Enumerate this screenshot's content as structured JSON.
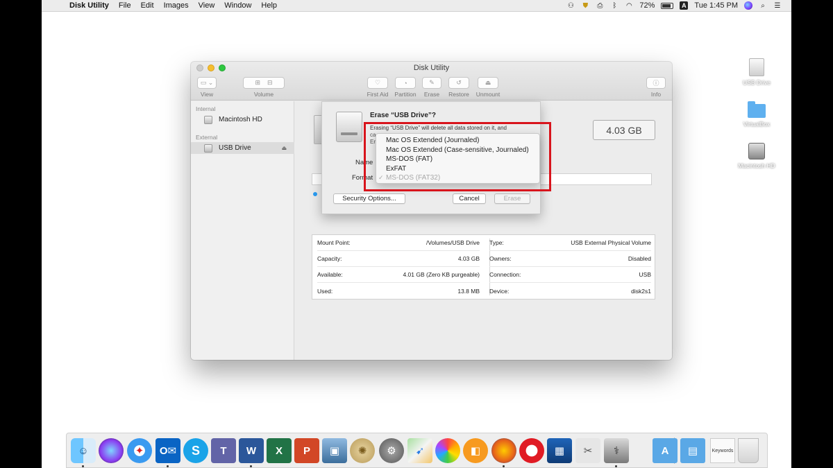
{
  "menubar": {
    "app_name": "Disk Utility",
    "menus": [
      "File",
      "Edit",
      "Images",
      "View",
      "Window",
      "Help"
    ],
    "battery": "72%",
    "keyboard_input": "A",
    "clock": "Tue 1:45 PM"
  },
  "window": {
    "title": "Disk Utility",
    "toolbar": {
      "view": "View",
      "volume": "Volume",
      "first_aid": "First Aid",
      "partition": "Partition",
      "erase": "Erase",
      "restore": "Restore",
      "unmount": "Unmount",
      "info": "Info"
    },
    "sidebar": {
      "internal_header": "Internal",
      "internal_item": "Macintosh HD",
      "external_header": "External",
      "external_item": "USB Drive"
    },
    "size": "4.03 GB",
    "info": {
      "left": [
        {
          "key": "Mount Point:",
          "value": "/Volumes/USB Drive"
        },
        {
          "key": "Capacity:",
          "value": "4.03 GB"
        },
        {
          "key": "Available:",
          "value": "4.01 GB (Zero KB purgeable)"
        },
        {
          "key": "Used:",
          "value": "13.8 MB"
        }
      ],
      "right": [
        {
          "key": "Type:",
          "value": "USB External Physical Volume"
        },
        {
          "key": "Owners:",
          "value": "Disabled"
        },
        {
          "key": "Connection:",
          "value": "USB"
        },
        {
          "key": "Device:",
          "value": "disk2s1"
        }
      ]
    }
  },
  "erase_sheet": {
    "title": "Erase “USB Drive”?",
    "description_line1": "Erasing “USB Drive” will delete all data stored on it, and",
    "description_line2": "ca",
    "description_line3": "Er",
    "name_label": "Name",
    "format_label": "Format",
    "security_button": "Security Options...",
    "cancel_button": "Cancel",
    "erase_button": "Erase"
  },
  "format_menu": {
    "options": [
      "Mac OS Extended (Journaled)",
      "Mac OS Extended (Case-sensitive, Journaled)",
      "MS-DOS (FAT)",
      "ExFAT"
    ],
    "selected": "MS-DOS (FAT32)",
    "check": "✓"
  },
  "desktop": {
    "icons": [
      "USB Drive",
      "VirtualBox",
      "Macintosh HD"
    ]
  },
  "dock": {
    "items": [
      "finder-icon",
      "siri-icon",
      "safari-icon",
      "outlook-icon",
      "skype-icon",
      "teams-icon",
      "word-icon",
      "excel-icon",
      "powerpoint-icon",
      "preview-icon",
      "photo-slideshow-icon",
      "system-preferences-icon",
      "maps-icon",
      "photos-icon",
      "ibooks-icon",
      "firefox-icon",
      "opera-icon",
      "virtualbox-icon",
      "grapher-icon",
      "disk-utility-icon",
      "applications-folder-icon",
      "documents-folder-icon",
      "keywords-file-icon",
      "trash-icon"
    ]
  },
  "colors": {
    "highlight": "#d8141c",
    "selection_dot": "#2a9df4"
  }
}
